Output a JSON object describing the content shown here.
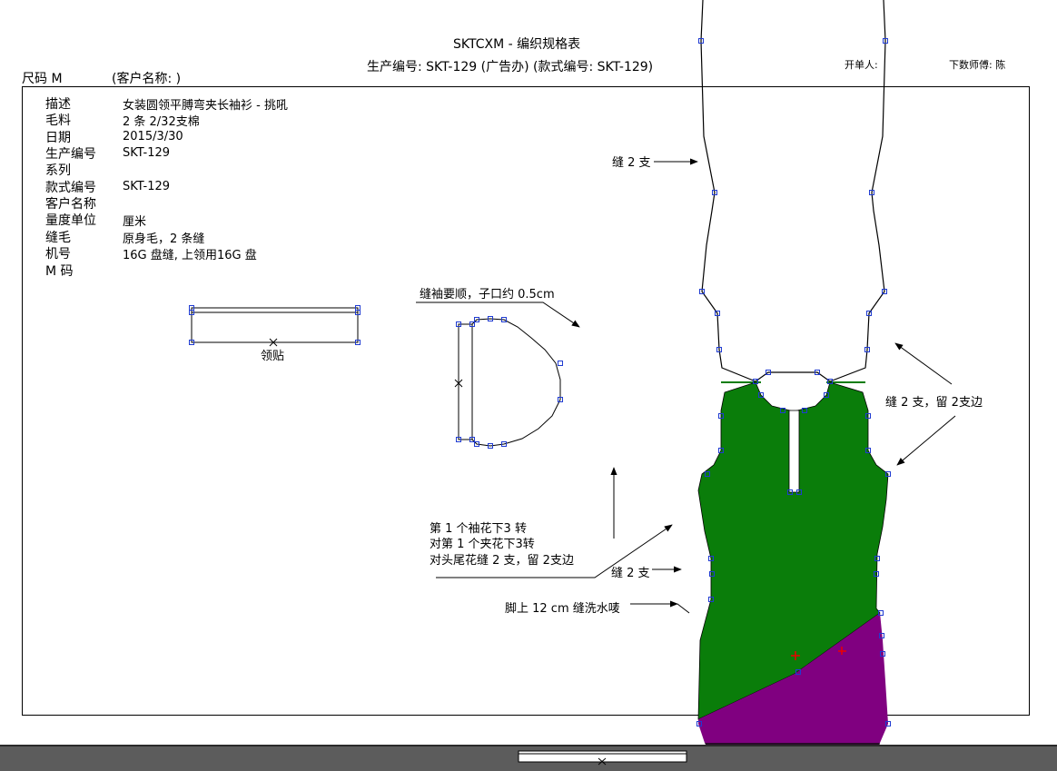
{
  "header": {
    "title": "SKTCXM - 编织规格表",
    "subtitle": "生产编号: SKT-129 (广告办)  (款式编号: SKT-129)",
    "size_label": "尺码  M",
    "customer_label": "(客户名称:                )",
    "opener_label": "开单人:",
    "issuer_label": "下数师傅: 陈"
  },
  "fields": [
    {
      "label": "描述",
      "value": "女装圆领平膊弯夹长袖衫 - 挑吼"
    },
    {
      "label": "毛料",
      "value": "2 条 2/32支棉"
    },
    {
      "label": "日期",
      "value": "2015/3/30"
    },
    {
      "label": "生产编号",
      "value": "SKT-129"
    },
    {
      "label": "系列",
      "value": ""
    },
    {
      "label": "款式编号",
      "value": "SKT-129"
    },
    {
      "label": "客户名称",
      "value": ""
    },
    {
      "label": "量度单位",
      "value": "厘米"
    },
    {
      "label": "缝毛",
      "value": "原身毛，2 条缝"
    },
    {
      "label": "机号",
      "value": "16G 盘缝, 上领用16G 盘"
    },
    {
      "label": "M 码",
      "value": ""
    }
  ],
  "annotations": {
    "collar_label": "领贴",
    "sleeve_note": "缝袖要顺，子口约 0.5cm",
    "sleeve_seam": "缝 2 支",
    "shoulder_seam": "缝 2 支，留 2支边",
    "pattern_line1": "第 1 个袖花下3 转",
    "pattern_line2": "对第 1 个夹花下3转",
    "pattern_line3": "对头尾花缝 2 支，留 2支边",
    "side_seam": "缝 2 支",
    "hem_note": "脚上 12 cm 缝洗水唛"
  },
  "colors": {
    "body_green": "#0a7d0a",
    "hem_purple": "#800080",
    "handle_blue": "#1f3bd1",
    "outline": "#000000"
  }
}
